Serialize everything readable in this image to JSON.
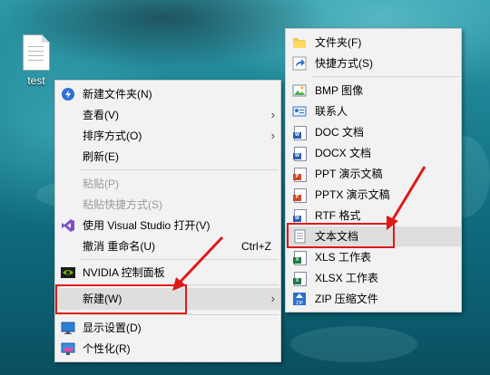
{
  "desktop": {
    "icon_label": "test"
  },
  "context_menu": {
    "items": [
      {
        "label": "新建文件夹(N)"
      },
      {
        "label": "查看(V)"
      },
      {
        "label": "排序方式(O)"
      },
      {
        "label": "刷新(E)"
      },
      {
        "label": "粘贴(P)"
      },
      {
        "label": "粘贴快捷方式(S)"
      },
      {
        "label": "使用 Visual Studio 打开(V)"
      },
      {
        "label": "撤消 重命名(U)",
        "shortcut": "Ctrl+Z"
      },
      {
        "label": "NVIDIA 控制面板"
      },
      {
        "label": "新建(W)"
      },
      {
        "label": "显示设置(D)"
      },
      {
        "label": "个性化(R)"
      }
    ]
  },
  "new_submenu": {
    "items": [
      {
        "label": "文件夹(F)"
      },
      {
        "label": "快捷方式(S)"
      },
      {
        "label": "BMP 图像"
      },
      {
        "label": "联系人"
      },
      {
        "label": "DOC 文档"
      },
      {
        "label": "DOCX 文档"
      },
      {
        "label": "PPT 演示文稿"
      },
      {
        "label": "PPTX 演示文稿"
      },
      {
        "label": "RTF 格式"
      },
      {
        "label": "文本文档"
      },
      {
        "label": "XLS 工作表"
      },
      {
        "label": "XLSX 工作表"
      },
      {
        "label": "ZIP 压缩文件"
      }
    ]
  },
  "icon_tags": {
    "word": "W",
    "powerpoint": "P",
    "excel": "X",
    "zip": "ZIP"
  },
  "colors": {
    "highlight": "#dedede",
    "annotation": "#e01818",
    "menu_bg": "#f2f2f2"
  }
}
